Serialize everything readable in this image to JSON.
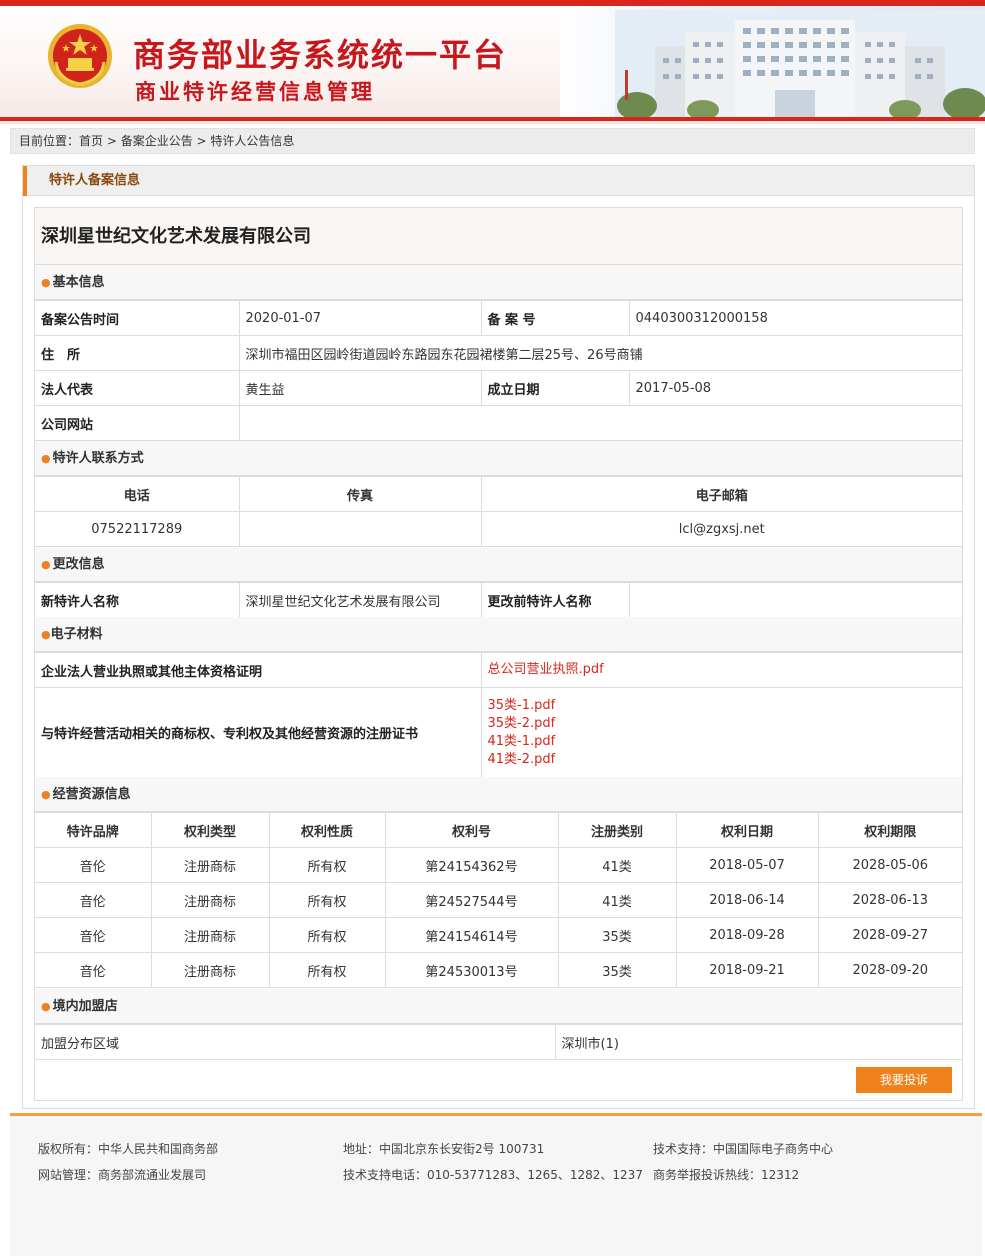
{
  "header": {
    "title": "商务部业务系统统一平台",
    "subtitle": "商业特许经营信息管理"
  },
  "breadcrumb": {
    "prefix": "目前位置：",
    "home": "首页",
    "sep1": " > ",
    "level2": "备案企业公告",
    "sep2": " > ",
    "level3": "特许人公告信息"
  },
  "panel_title": "特许人备案信息",
  "company_name": "深圳星世纪文化艺术发展有限公司",
  "basic": {
    "section_title": "基本信息",
    "record_date_label": "备案公告时间",
    "record_date": "2020-01-07",
    "record_no_label": "备 案 号",
    "record_no": "0440300312000158",
    "address_label": "住　所",
    "address": "深圳市福田区园岭街道园岭东路园东花园裙楼第二层25号、26号商铺",
    "legal_rep_label": "法人代表",
    "legal_rep": "黄生益",
    "founded_label": "成立日期",
    "founded": "2017-05-08",
    "website_label": "公司网站",
    "website": ""
  },
  "contact": {
    "section_title": "特许人联系方式",
    "phone_label": "电话",
    "fax_label": "传真",
    "email_label": "电子邮箱",
    "phone": "07522117289",
    "fax": "",
    "email": "lcl@zgxsj.net"
  },
  "change": {
    "section_title": "更改信息",
    "new_name_label": "新特许人名称",
    "new_name": "深圳星世纪文化艺术发展有限公司",
    "old_name_label": "更改前特许人名称",
    "old_name": ""
  },
  "materials": {
    "section_title": "电子材料",
    "license_label": "企业法人营业执照或其他主体资格证明",
    "license_file": "总公司营业执照.pdf",
    "cert_label": "与特许经营活动相关的商标权、专利权及其他经营资源的注册证书",
    "cert_files": [
      "35类-1.pdf",
      "35类-2.pdf",
      "41类-1.pdf",
      "41类-2.pdf"
    ]
  },
  "resources": {
    "section_title": "经营资源信息",
    "headers": [
      "特许品牌",
      "权利类型",
      "权利性质",
      "权利号",
      "注册类别",
      "权利日期",
      "权利期限"
    ],
    "rows": [
      [
        "音伦",
        "注册商标",
        "所有权",
        "第24154362号",
        "41类",
        "2018-05-07",
        "2028-05-06"
      ],
      [
        "音伦",
        "注册商标",
        "所有权",
        "第24527544号",
        "41类",
        "2018-06-14",
        "2028-06-13"
      ],
      [
        "音伦",
        "注册商标",
        "所有权",
        "第24154614号",
        "35类",
        "2018-09-28",
        "2028-09-27"
      ],
      [
        "音伦",
        "注册商标",
        "所有权",
        "第24530013号",
        "35类",
        "2018-09-21",
        "2028-09-20"
      ]
    ]
  },
  "domestic": {
    "section_title": "境内加盟店",
    "region_label": "加盟分布区域",
    "region_value": "深圳市(1)"
  },
  "complain_button": "我要投诉",
  "footer": {
    "copyright": "版权所有：中华人民共和国商务部",
    "address": "地址：中国北京东长安街2号 100731",
    "tech_support": "技术支持：中国国际电子商务中心",
    "site_admin": "网站管理：商务部流通业发展司",
    "tech_phone": "技术支持电话：010-53771283、1265、1282、1237",
    "hotline": "商务举报投诉热线：12312"
  },
  "colors": {
    "brand_red": "#c8161d",
    "accent_orange": "#f0821e",
    "link_red": "#d9261c"
  }
}
